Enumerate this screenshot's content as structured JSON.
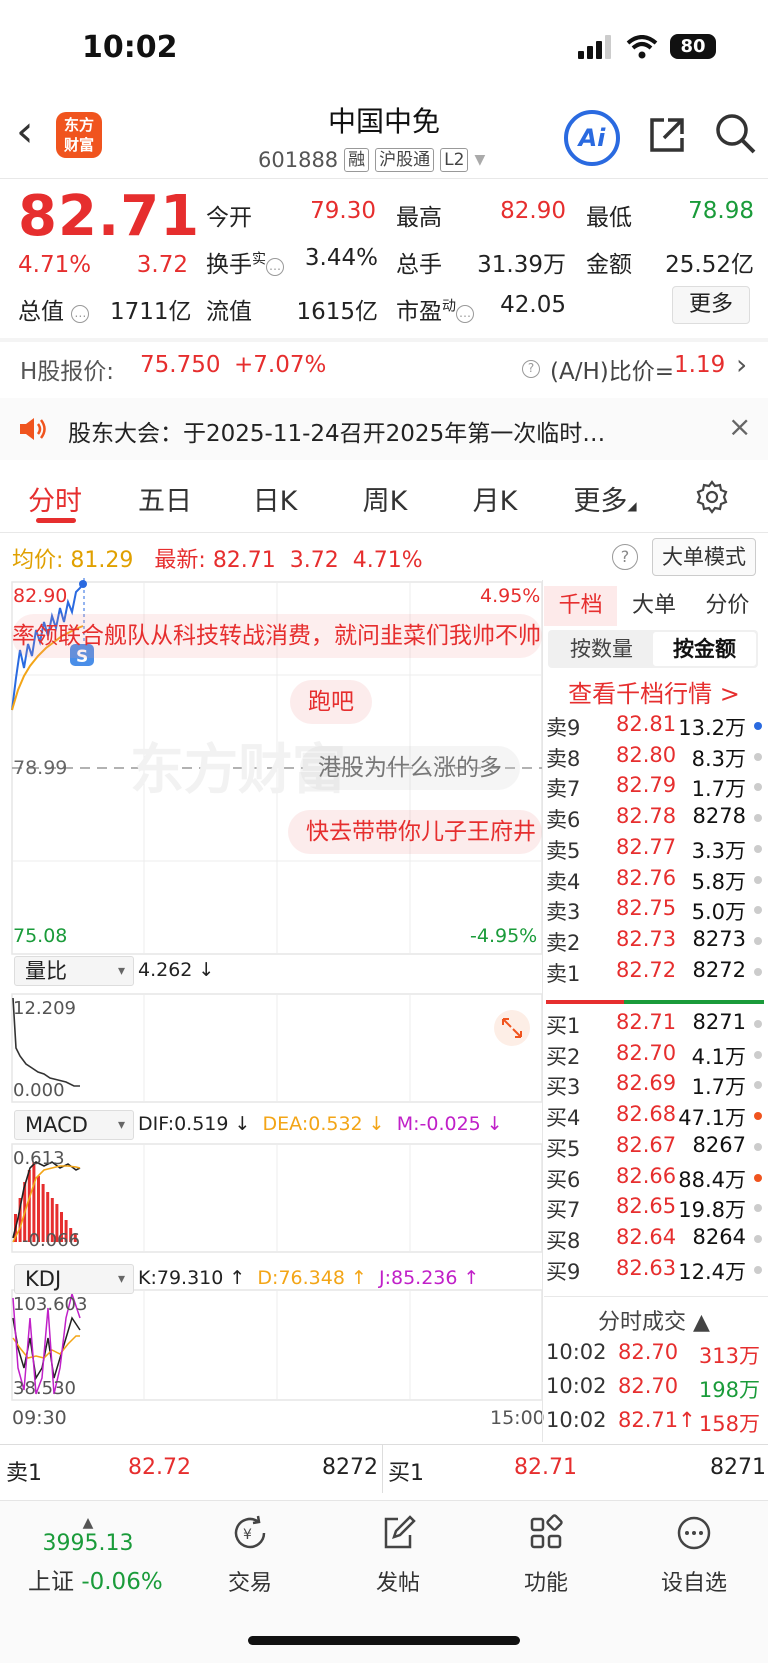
{
  "status_bar": {
    "time": "10:02",
    "battery": "80"
  },
  "nav": {
    "logo_line1": "东方",
    "logo_line2": "财富",
    "title": "中国中免",
    "code": "601888",
    "tags": [
      "融",
      "沪股通",
      "L2"
    ],
    "ai_label": "Ai"
  },
  "quote": {
    "price": "82.71",
    "change_pct": "4.71%",
    "change": "3.72",
    "open_label": "今开",
    "open": "79.30",
    "high_label": "最高",
    "high": "82.90",
    "low_label": "最低",
    "low": "78.98",
    "turnover_label": "换手",
    "turnover_sup": "实",
    "turnover": "3.44%",
    "volume_label": "总手",
    "volume": "31.39万",
    "amount_label": "金额",
    "amount": "25.52亿",
    "mktcap_label": "总值",
    "mktcap": "1711亿",
    "float_label": "流值",
    "float": "1615亿",
    "pe_label": "市盈",
    "pe_sup": "动",
    "pe": "42.05",
    "more_label": "更多"
  },
  "h_share": {
    "label": "H股报价:",
    "price": "75.750",
    "change": "+7.07%",
    "ratio_label": "(A/H)比价=",
    "ratio": "1.19"
  },
  "notice": {
    "text": "股东大会：于2025-11-24召开2025年第一次临时…"
  },
  "tabs": [
    "分时",
    "五日",
    "日K",
    "周K",
    "月K",
    "更多"
  ],
  "chart_info": {
    "avg_label": "均价:",
    "avg": "81.29",
    "last_label": "最新:",
    "last": "82.71",
    "chg": "3.72",
    "pct": "4.71%",
    "big_order_mode": "大单模式"
  },
  "chart": {
    "price_top": "82.90",
    "pct_top": "4.95%",
    "price_mid": "78.99",
    "price_bottom": "75.08",
    "pct_bottom": "-4.95%",
    "time_start": "09:30",
    "time_end": "15:00",
    "s_badge": "S",
    "danmu": [
      "率领联合舰队从科技转战消费，就问韭菜们我帅不帅",
      "跑吧",
      "港股为什么涨的多",
      "快去带带你儿子王府井"
    ]
  },
  "indicators": {
    "vol_ratio": {
      "name": "量比",
      "value": "4.262 ↓",
      "top": "12.209",
      "bottom": "0.000"
    },
    "macd": {
      "name": "MACD",
      "dif": "DIF:0.519 ↓",
      "dea": "DEA:0.532 ↓",
      "m": "M:-0.025 ↓",
      "top": "0.613",
      "bottom": "-0.066"
    },
    "kdj": {
      "name": "KDJ",
      "k": "K:79.310 ↑",
      "d": "D:76.348 ↑",
      "j": "J:85.236 ↑",
      "top": "103.603",
      "bottom": "38.530"
    }
  },
  "order_book": {
    "tabs": [
      "千档",
      "大单",
      "分价"
    ],
    "seg": [
      "按数量",
      "按金额"
    ],
    "link": "查看千档行情 >",
    "asks": [
      {
        "label": "卖9",
        "price": "82.81",
        "vol": "13.2万",
        "dot": "#2a6ae0"
      },
      {
        "label": "卖8",
        "price": "82.80",
        "vol": "8.3万",
        "dot": "#ccc"
      },
      {
        "label": "卖7",
        "price": "82.79",
        "vol": "1.7万",
        "dot": "#ccc"
      },
      {
        "label": "卖6",
        "price": "82.78",
        "vol": "8278",
        "dot": "#ccc"
      },
      {
        "label": "卖5",
        "price": "82.77",
        "vol": "3.3万",
        "dot": "#ccc"
      },
      {
        "label": "卖4",
        "price": "82.76",
        "vol": "5.8万",
        "dot": "#ccc"
      },
      {
        "label": "卖3",
        "price": "82.75",
        "vol": "5.0万",
        "dot": "#ccc"
      },
      {
        "label": "卖2",
        "price": "82.73",
        "vol": "8273",
        "dot": "#ccc"
      },
      {
        "label": "卖1",
        "price": "82.72",
        "vol": "8272",
        "dot": "#ccc"
      }
    ],
    "bids": [
      {
        "label": "买1",
        "price": "82.71",
        "vol": "8271",
        "dot": "#ccc"
      },
      {
        "label": "买2",
        "price": "82.70",
        "vol": "4.1万",
        "dot": "#ccc"
      },
      {
        "label": "买3",
        "price": "82.69",
        "vol": "1.7万",
        "dot": "#ccc"
      },
      {
        "label": "买4",
        "price": "82.68",
        "vol": "47.1万",
        "dot": "#f0541e"
      },
      {
        "label": "买5",
        "price": "82.67",
        "vol": "8267",
        "dot": "#ccc"
      },
      {
        "label": "买6",
        "price": "82.66",
        "vol": "88.4万",
        "dot": "#f0541e"
      },
      {
        "label": "买7",
        "price": "82.65",
        "vol": "19.8万",
        "dot": "#ccc"
      },
      {
        "label": "买8",
        "price": "82.64",
        "vol": "8264",
        "dot": "#ccc"
      },
      {
        "label": "买9",
        "price": "82.63",
        "vol": "12.4万",
        "dot": "#ccc"
      }
    ]
  },
  "time_sales": {
    "title": "分时成交 ▲",
    "rows": [
      {
        "time": "10:02",
        "price": "82.70",
        "vol": "313万",
        "dir": "red"
      },
      {
        "time": "10:02",
        "price": "82.70",
        "vol": "198万",
        "dir": "green"
      },
      {
        "time": "10:02",
        "price": "82.71↑",
        "vol": "158万",
        "dir": "red"
      }
    ]
  },
  "bottom_quote": {
    "ask_label": "卖1",
    "ask_price": "82.72",
    "ask_vol": "8272",
    "bid_label": "买1",
    "bid_price": "82.71",
    "bid_vol": "8271"
  },
  "bottom_nav": {
    "index_value": "3995.13",
    "index_name": "上证",
    "index_change": "-0.06%",
    "items": [
      "交易",
      "发帖",
      "功能",
      "设自选"
    ]
  },
  "colors": {
    "red": "#e62e2e",
    "green": "#1a9b3a",
    "brand": "#f0541e",
    "ai_blue": "#2a6ae0"
  }
}
